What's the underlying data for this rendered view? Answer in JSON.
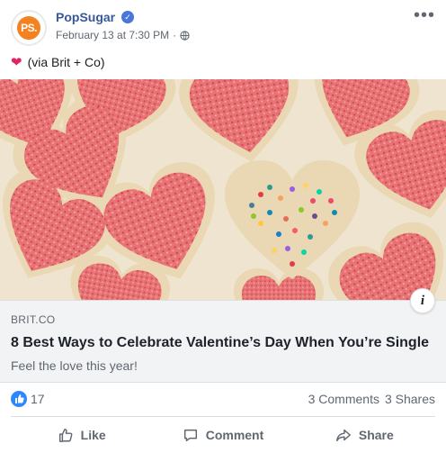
{
  "post": {
    "page_name": "PopSugar",
    "avatar_text": "PS.",
    "timestamp": "February 13 at 7:30 PM",
    "separator": "·",
    "more_label": "•••",
    "caption": "(via Brit + Co)"
  },
  "link_preview": {
    "domain": "BRIT.CO",
    "title": "8 Best Ways to Celebrate Valentine’s Day When You’re Single",
    "description": "Feel the love this year!",
    "info_label": "i"
  },
  "stats": {
    "likes": "17",
    "comments": "3 Comments",
    "shares": "3 Shares"
  },
  "actions": {
    "like": "Like",
    "comment": "Comment",
    "share": "Share"
  },
  "icons": {
    "verified": "verified-badge-icon",
    "globe": "globe-icon",
    "heart": "heart-emoji-icon",
    "like": "thumbs-up-icon",
    "comment": "comment-bubble-icon",
    "share": "share-arrow-icon"
  },
  "colors": {
    "brand_orange": "#f58220",
    "link_blue": "#385898",
    "like_blue": "#2d88ff"
  }
}
